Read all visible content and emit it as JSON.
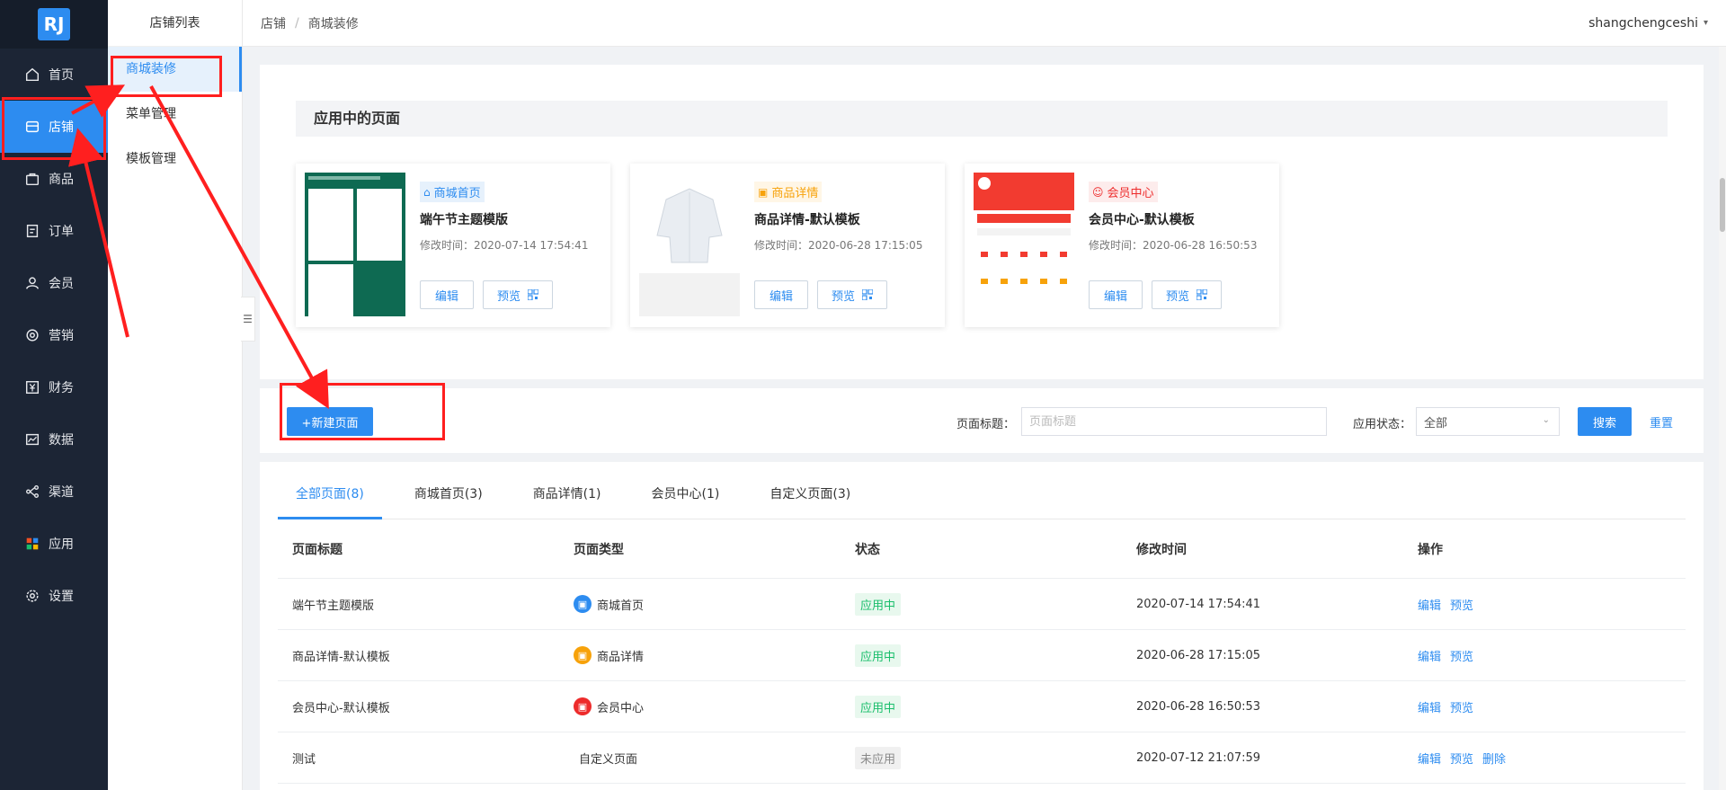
{
  "logo": {
    "text": "RJ"
  },
  "sidebar": {
    "items": [
      {
        "label": "首页",
        "icon": "home-icon"
      },
      {
        "label": "店铺",
        "icon": "store-icon",
        "active": true
      },
      {
        "label": "商品",
        "icon": "bag-icon"
      },
      {
        "label": "订单",
        "icon": "order-icon"
      },
      {
        "label": "会员",
        "icon": "user-icon"
      },
      {
        "label": "营销",
        "icon": "marketing-icon"
      },
      {
        "label": "财务",
        "icon": "finance-icon"
      },
      {
        "label": "数据",
        "icon": "data-icon"
      },
      {
        "label": "渠道",
        "icon": "channel-icon"
      },
      {
        "label": "应用",
        "icon": "apps-icon"
      },
      {
        "label": "设置",
        "icon": "settings-icon"
      }
    ]
  },
  "subbar": {
    "title": "店铺列表",
    "items": [
      {
        "label": "商城装修",
        "active": true
      },
      {
        "label": "菜单管理"
      },
      {
        "label": "模板管理"
      }
    ]
  },
  "header": {
    "breadcrumb": [
      "店铺",
      "商城装修"
    ],
    "separator": "/",
    "user": "shangchengceshi"
  },
  "applied": {
    "title": "应用中的页面",
    "templates": [
      {
        "type": "商城首页",
        "type_color": "#2d8cf0",
        "type_bg": "#e6f1fc",
        "name": "端午节主题模版",
        "time": "修改时间：2020-07-14 17:54:41",
        "edit": "编辑",
        "preview": "预览"
      },
      {
        "type": "商品详情",
        "type_color": "#f7a20a",
        "type_bg": "#fff6e6",
        "name": "商品详情-默认模板",
        "time": "修改时间：2020-06-28 17:15:05",
        "edit": "编辑",
        "preview": "预览"
      },
      {
        "type": "会员中心",
        "type_color": "#ed2b2b",
        "type_bg": "#fdecec",
        "name": "会员中心-默认模板",
        "time": "修改时间：2020-06-28 16:50:53",
        "edit": "编辑",
        "preview": "预览"
      }
    ]
  },
  "toolbar": {
    "new_label": "+新建页面",
    "title_label": "页面标题：",
    "title_placeholder": "页面标题",
    "status_label": "应用状态：",
    "status_value": "全部",
    "search_label": "搜索",
    "reset_label": "重置"
  },
  "tabs": [
    "全部页面(8)",
    "商城首页(3)",
    "商品详情(1)",
    "会员中心(1)",
    "自定义页面(3)"
  ],
  "table": {
    "headers": [
      "页面标题",
      "页面类型",
      "状态",
      "修改时间",
      "操作"
    ],
    "rows": [
      {
        "title": "端午节主题模版",
        "type": "商城首页",
        "type_color": "#2d8cf0",
        "status": "应用中",
        "applied": true,
        "time": "2020-07-14 17:54:41",
        "ops": [
          "编辑",
          "预览"
        ]
      },
      {
        "title": "商品详情-默认模板",
        "type": "商品详情",
        "type_color": "#f7a20a",
        "status": "应用中",
        "applied": true,
        "time": "2020-06-28 17:15:05",
        "ops": [
          "编辑",
          "预览"
        ]
      },
      {
        "title": "会员中心-默认模板",
        "type": "会员中心",
        "type_color": "#ed2b2b",
        "status": "应用中",
        "applied": true,
        "time": "2020-06-28 16:50:53",
        "ops": [
          "编辑",
          "预览"
        ]
      },
      {
        "title": "测试",
        "type": "自定义页面",
        "type_color": "",
        "status": "未应用",
        "applied": false,
        "time": "2020-07-12 21:07:59",
        "ops": [
          "编辑",
          "预览",
          "删除"
        ]
      }
    ]
  }
}
